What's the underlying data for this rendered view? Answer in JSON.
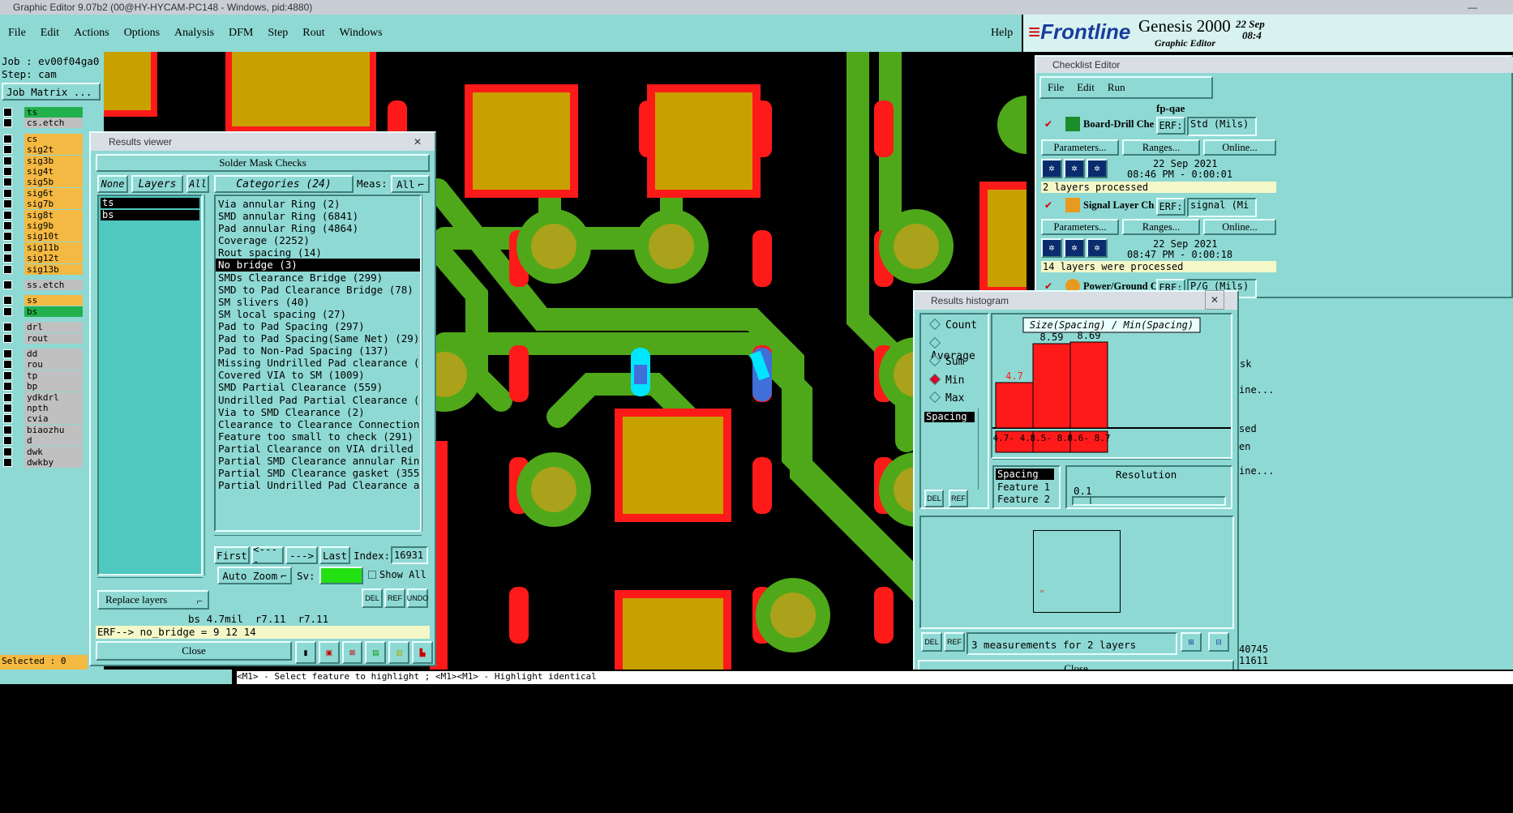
{
  "window_title": "Graphic Editor 9.07b2 (00@HY-HYCAM-PC148 - Windows, pid:4880)",
  "menu": [
    "File",
    "Edit",
    "Actions",
    "Options",
    "Analysis",
    "DFM",
    "Step",
    "Rout",
    "Windows"
  ],
  "help": "Help",
  "brand": {
    "logo": "Frontline",
    "product": "Genesis 2000",
    "subtitle": "Graphic Editor",
    "date_line1": "22 Sep",
    "date_line2": "08:4"
  },
  "job": {
    "job_line": "Job : ev00f04ga0",
    "step_line": "Step: cam",
    "matrix_button": "Job Matrix ..."
  },
  "layers": [
    {
      "name": "ts",
      "color": "#22b14c"
    },
    {
      "name": "cs.etch",
      "color": "#c0c0c0"
    },
    {
      "name": "cs",
      "color": "#f4b942"
    },
    {
      "name": "sig2t",
      "color": "#f4b942"
    },
    {
      "name": "sig3b",
      "color": "#f4b942"
    },
    {
      "name": "sig4t",
      "color": "#f4b942"
    },
    {
      "name": "sig5b",
      "color": "#f4b942"
    },
    {
      "name": "sig6t",
      "color": "#f4b942"
    },
    {
      "name": "sig7b",
      "color": "#f4b942"
    },
    {
      "name": "sig8t",
      "color": "#f4b942"
    },
    {
      "name": "sig9b",
      "color": "#f4b942"
    },
    {
      "name": "sig10t",
      "color": "#f4b942"
    },
    {
      "name": "sig11b",
      "color": "#f4b942"
    },
    {
      "name": "sig12t",
      "color": "#f4b942"
    },
    {
      "name": "sig13b",
      "color": "#f4b942"
    },
    {
      "name": "ss.etch",
      "color": "#c0c0c0"
    },
    {
      "name": "ss",
      "color": "#f4b942"
    },
    {
      "name": "bs",
      "color": "#22b14c"
    },
    {
      "name": "drl",
      "color": "#c0c0c0"
    },
    {
      "name": "rout",
      "color": "#c0c0c0"
    },
    {
      "name": "dd",
      "color": "#c0c0c0"
    },
    {
      "name": "rou",
      "color": "#c0c0c0"
    },
    {
      "name": "tp",
      "color": "#c0c0c0"
    },
    {
      "name": "bp",
      "color": "#c0c0c0"
    },
    {
      "name": "ydkdrl",
      "color": "#c0c0c0"
    },
    {
      "name": "npth",
      "color": "#c0c0c0"
    },
    {
      "name": "cvia",
      "color": "#c0c0c0"
    },
    {
      "name": "biaozhu",
      "color": "#c0c0c0"
    },
    {
      "name": "d",
      "color": "#c0c0c0"
    },
    {
      "name": "dwk",
      "color": "#c0c0c0"
    },
    {
      "name": "dwkby",
      "color": "#c0c0c0"
    }
  ],
  "selected": "Selected : 0",
  "status_bar": "<M1> - Select feature to highlight ; <M1><M1> - Highlight identical",
  "results_viewer": {
    "title": "Results viewer",
    "header": "Solder Mask Checks",
    "none_btn": "None",
    "layers_btn": "Layers",
    "all_btn": "All",
    "categories_btn": "Categories (24)",
    "meas_label": "Meas:",
    "meas_value": "All",
    "layer_list": [
      "ts",
      "bs"
    ],
    "categories": [
      "Via annular Ring (2)",
      "SMD annular Ring (6841)",
      "Pad annular Ring (4864)",
      "Coverage (2252)",
      "Rout spacing (14)",
      "No bridge (3)",
      "SMDs Clearance Bridge (299)",
      "SMD to Pad Clearance Bridge (78)",
      "SM slivers (40)",
      "SM local spacing (27)",
      "Pad to Pad Spacing (297)",
      "Pad to Pad Spacing(Same Net) (29)",
      "Pad to Non-Pad Spacing (137)",
      "Missing Undrilled Pad clearance (",
      "Covered VIA to SM (1009)",
      "SMD Partial Clearance (559)",
      "Undrilled Pad Partial Clearance (",
      "Via to SMD Clearance (2)",
      "Clearance to Clearance Connection",
      "Feature too small to check (291)",
      "Partial Clearance on VIA drilled",
      "Partial SMD Clearance annular Rin",
      "Partial SMD Clearance gasket (355",
      "Partial Undrilled Pad Clearance a"
    ],
    "selected_index": 5,
    "first_btn": "First",
    "prev_btn": "<----",
    "next_btn": "--->",
    "last_btn": "Last",
    "index_label": "Index:",
    "index_value": "16931",
    "autozoom": "Auto Zoom",
    "sv_label": "Sv:",
    "show_all": "Show All",
    "replace_layers": "Replace layers",
    "del": "DEL",
    "ref": "REF",
    "undo": "UNDO",
    "result_line": "bs 4.7mil  r7.11  r7.11",
    "erf_line": "ERF--> no_bridge = 9 12 14",
    "close": "Close"
  },
  "checklist": {
    "title": "Checklist Editor",
    "menu": [
      "File",
      "Edit",
      "Run"
    ],
    "name": "fp-qae",
    "params": "Parameters...",
    "ranges": "Ranges...",
    "online": "Online...",
    "erf": "ERF:",
    "items": [
      {
        "name": "Board-Drill Che",
        "erf_value": "Std (Mils)",
        "date": "22 Sep 2021",
        "time": "08:46 PM - 0:00:01",
        "status": "2 layers processed"
      },
      {
        "name": "Signal Layer Ch",
        "erf_value": "signal (Mi",
        "date": "22 Sep 2021",
        "time": "08:47 PM - 0:00:18",
        "status": "14 layers were processed"
      },
      {
        "name": "Power/Ground C",
        "erf_value": "P/G (Mils)"
      }
    ],
    "right_fragments": [
      "sk",
      "ine...",
      "sed",
      "en",
      "ine..."
    ]
  },
  "histogram": {
    "title": "Results histogram",
    "modes": [
      "Count",
      "Average",
      "Sum",
      "Min",
      "Max"
    ],
    "selected_mode": "Min",
    "list": [
      "Spacing"
    ],
    "chart_title": "Size(Spacing) / Min(Spacing)",
    "bars": [
      {
        "label": "4.7",
        "range": "4.7- 4.8",
        "value": 4.7
      },
      {
        "label": "8.59",
        "range": "8.5- 8.6",
        "value": 8.59
      },
      {
        "label": "8.69",
        "range": "8.6- 8.7",
        "value": 8.69
      }
    ],
    "params_list": [
      "Spacing",
      "Feature 1",
      "Feature 2"
    ],
    "resolution_label": "Resolution",
    "resolution_value": "0.1",
    "summary": "3 measurements for 2 layers",
    "close": "Close",
    "del": "DEL",
    "ref": "REF"
  },
  "right_numbers": [
    "40745",
    "11611"
  ]
}
